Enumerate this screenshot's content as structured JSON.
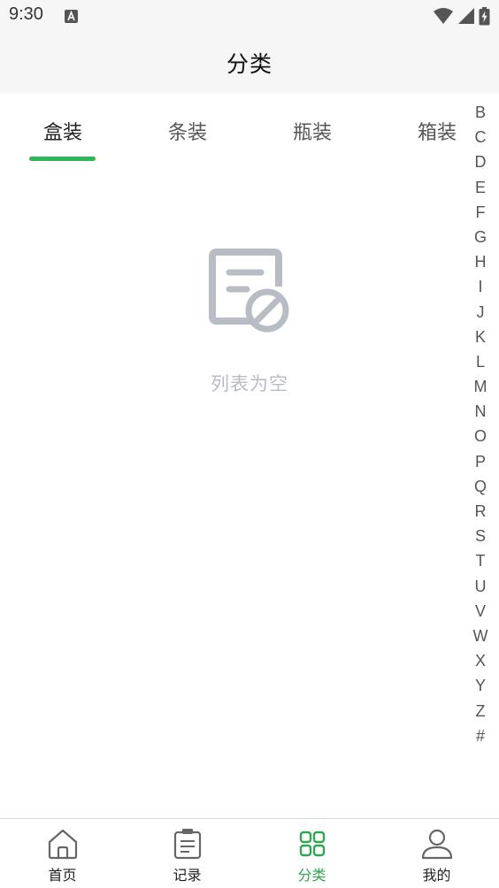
{
  "status_bar": {
    "time": "9:30",
    "notification_icon": "text-a-icon",
    "icons": [
      "wifi-icon",
      "cell-signal-icon",
      "battery-charging-icon"
    ]
  },
  "header": {
    "title": "分类"
  },
  "tabs": [
    {
      "label": "盒装",
      "active": true
    },
    {
      "label": "条装",
      "active": false
    },
    {
      "label": "瓶装",
      "active": false
    },
    {
      "label": "箱装",
      "active": false
    }
  ],
  "alphabet_index": [
    "B",
    "C",
    "D",
    "E",
    "F",
    "G",
    "H",
    "I",
    "J",
    "K",
    "L",
    "M",
    "N",
    "O",
    "P",
    "Q",
    "R",
    "S",
    "T",
    "U",
    "V",
    "W",
    "X",
    "Y",
    "Z",
    "#"
  ],
  "empty_state": {
    "icon": "empty-list-icon",
    "text": "列表为空"
  },
  "bottom_nav": [
    {
      "label": "首页",
      "icon": "home-icon",
      "active": false
    },
    {
      "label": "记录",
      "icon": "clipboard-icon",
      "active": false
    },
    {
      "label": "分类",
      "icon": "grid-icon",
      "active": true
    },
    {
      "label": "我的",
      "icon": "user-icon",
      "active": false
    }
  ],
  "colors": {
    "accent": "#2fb65a",
    "header_bg": "#f6f6f6",
    "empty_gray": "#b8bcc4"
  }
}
